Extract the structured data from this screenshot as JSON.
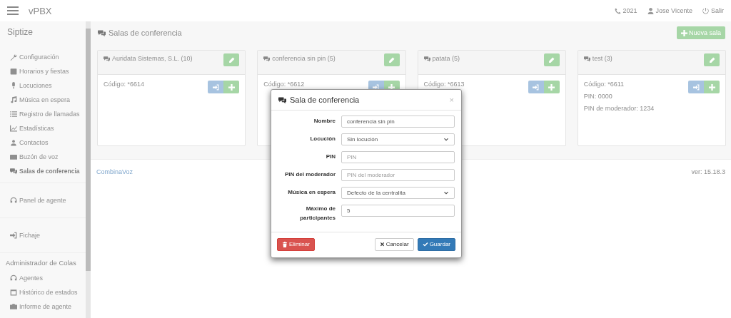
{
  "topbar": {
    "brand": "vPBX",
    "extension": "2021",
    "user": "Jose Vicente",
    "logout": "Salir"
  },
  "sidebar": {
    "title": "Siptize",
    "sections": [
      {
        "items": [
          {
            "label": "Configuración",
            "selected": false
          },
          {
            "label": "Horarios y fiestas",
            "selected": false
          },
          {
            "label": "Locuciones",
            "selected": false
          },
          {
            "label": "Música en espera",
            "selected": false
          },
          {
            "label": "Registro de llamadas",
            "selected": false
          },
          {
            "label": "Estadísticas",
            "selected": false
          },
          {
            "label": "Contactos",
            "selected": false
          },
          {
            "label": "Buzón de voz",
            "selected": false
          },
          {
            "label": "Salas de conferencia",
            "selected": true
          }
        ]
      },
      {
        "items": [
          {
            "label": "Panel de agente",
            "selected": false
          }
        ]
      },
      {
        "items": [
          {
            "label": "Fichaje",
            "selected": false
          }
        ]
      },
      {
        "heading": "Administrador de Colas",
        "items": [
          {
            "label": "Agentes",
            "selected": false
          },
          {
            "label": "Histórico de estados",
            "selected": false
          },
          {
            "label": "Informe de agente",
            "selected": false
          }
        ]
      }
    ]
  },
  "page": {
    "title": "Salas de conferencia",
    "new_button": "Nueva sala"
  },
  "rooms": [
    {
      "title": "Auridata Sistemas, S.L. (10)",
      "lines": [
        "Código: *6614"
      ]
    },
    {
      "title": "conferencia sin pin (5)",
      "lines": [
        "Código: *6612"
      ]
    },
    {
      "title": "patata (5)",
      "lines": [
        "Código: *6613"
      ]
    },
    {
      "title": "test (3)",
      "lines": [
        "Código: *6611",
        "PIN: 0000",
        "PIN de moderador: 1234"
      ]
    }
  ],
  "footer": {
    "link": "CombinaVoz",
    "version": "ver: 15.18.3"
  },
  "dialog": {
    "title": "Sala de conferencia",
    "close": "×",
    "fields": [
      {
        "label": "Nombre",
        "kind": "text",
        "value": "conferencia sin pin"
      },
      {
        "label": "Locución",
        "kind": "select",
        "value": "Sin locución"
      },
      {
        "label": "PIN",
        "kind": "text",
        "placeholder": "PIN"
      },
      {
        "label": "PIN del moderador",
        "kind": "text",
        "placeholder": "PIN del moderador"
      },
      {
        "label": "Música en espera",
        "kind": "select",
        "value": "Defecto de la centralita"
      },
      {
        "label": "Máximo de participantes",
        "kind": "text",
        "value": "5"
      }
    ],
    "delete": "Eliminar",
    "cancel": "Cancelar",
    "save": "Guardar"
  }
}
